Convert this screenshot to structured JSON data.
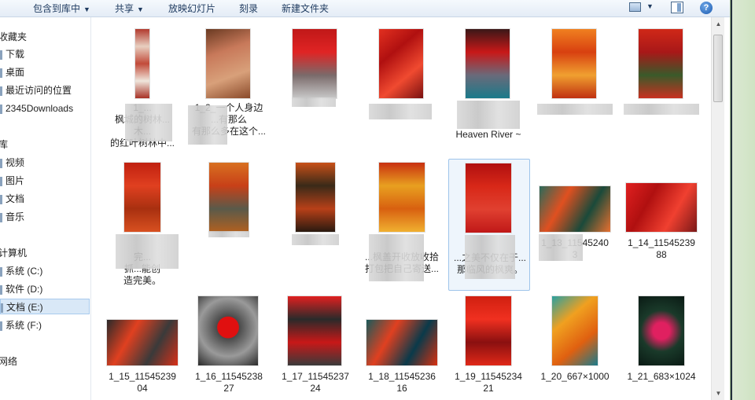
{
  "toolbar": {
    "include_in_library": "包含到库中",
    "share": "共享",
    "slideshow": "放映幻灯片",
    "burn": "刻录",
    "new_folder": "新建文件夹"
  },
  "nav": {
    "favorites": "收藏夹",
    "downloads": "下载",
    "desktop": "桌面",
    "recent_places": "最近访问的位置",
    "downloads_2345": "2345Downloads",
    "libraries": "库",
    "videos": "视频",
    "pictures": "图片",
    "documents": "文档",
    "music": "音乐",
    "computer": "计算机",
    "drive_c": "系统 (C:)",
    "drive_d": "软件 (D:)",
    "drive_e": "文档 (E:)",
    "drive_f": "系统 (F:)",
    "network": "网络"
  },
  "files": {
    "r1": [
      "1_...\n枫城的树林...\n木...\n的红叶树林中...",
      "1_2_一个人身边\n...有那么\n有那么多在这个...",
      "",
      "",
      "Heaven River ~",
      "",
      ""
    ],
    "r2": [
      "完...\n抓...能创\n造完美。",
      "",
      "",
      "...枫盖开收放收拾\n打包把自己寄送...",
      "...之美不仅在于...\n那临风的枫爽。",
      "1_13_11545240\n3",
      "1_14_11545239\n88"
    ],
    "r3": [
      "1_15_11545239\n04",
      "1_16_11545238\n27",
      "1_17_11545237\n24",
      "1_18_11545236\n16",
      "1_19_11545234\n21",
      "1_20_667×1000",
      "1_21_683×1024"
    ]
  },
  "colors": {
    "toolbar_bg": "#e4ecf6",
    "selection": "#d9e8f7",
    "right_strip": "#cfe3c3"
  }
}
